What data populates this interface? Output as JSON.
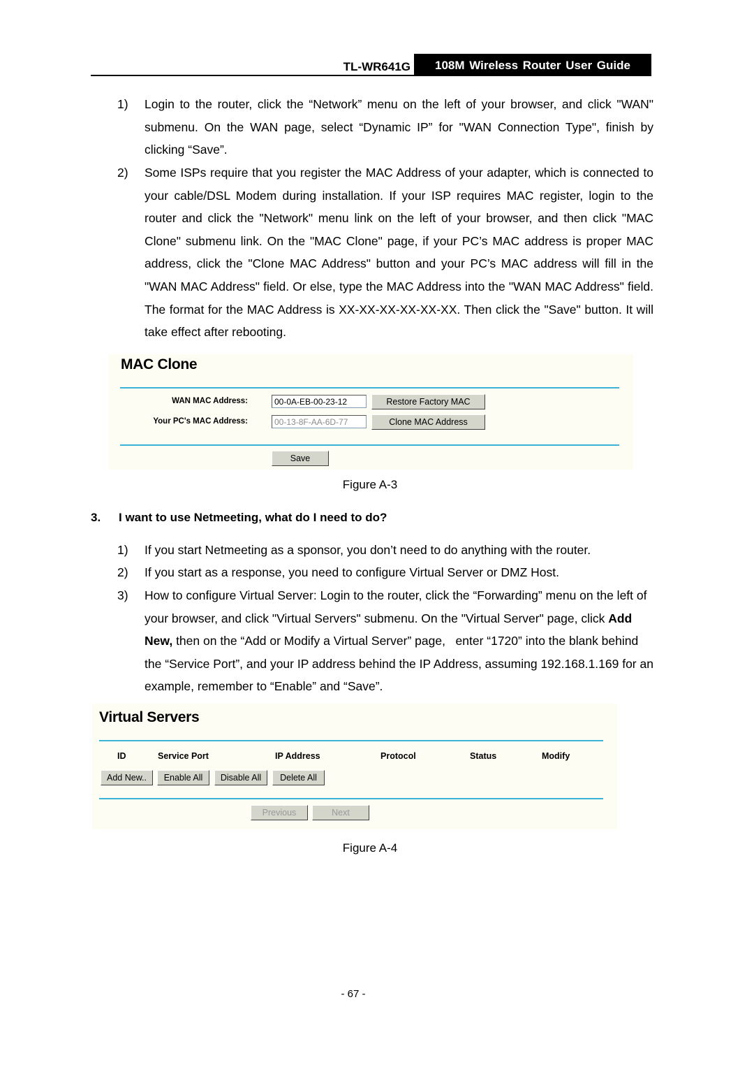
{
  "header": {
    "model": "TL-WR641G",
    "guide_title": "108M Wireless Router User Guide"
  },
  "section_mac": {
    "items": [
      {
        "num": "1)",
        "text": "Login to the router, click the “Network” menu on the left of your browser, and click \"WAN\" submenu. On the WAN page, select “Dynamic IP” for \"WAN Connection Type\", finish by clicking “Save”."
      },
      {
        "num": "2)",
        "text": "Some ISPs require that you register the MAC Address of your adapter, which is connected to your cable/DSL Modem during installation. If your ISP requires MAC register, login to the router and click the \"Network\" menu link on the left of your browser, and then click \"MAC Clone\" submenu link. On the \"MAC Clone\" page, if your PC’s MAC address is proper MAC address, click the \"Clone MAC Address\" button and your PC’s MAC address will fill in the \"WAN MAC Address\" field. Or else, type the MAC Address into the \"WAN MAC Address\" field. The format for the MAC Address is XX-XX-XX-XX-XX-XX. Then click the \"Save\" button. It will take effect after rebooting."
      }
    ]
  },
  "figure_a3": {
    "title": "MAC Clone",
    "wan_mac_label": "WAN MAC Address:",
    "wan_mac_value": "00-0A-EB-00-23-12",
    "restore_button": "Restore Factory MAC",
    "pc_mac_label": "Your PC's MAC Address:",
    "pc_mac_value": "00-13-8F-AA-6D-77",
    "clone_button": "Clone MAC Address",
    "save_button": "Save",
    "caption": "Figure A-3"
  },
  "question3": {
    "num": "3.",
    "title": "I want to use Netmeeting, what do I need to do?",
    "items": [
      {
        "num": "1)",
        "text": "If you start Netmeeting as a sponsor, you don’t need to do anything with the router."
      },
      {
        "num": "2)",
        "text": "If you start as a response, you need to configure Virtual Server or DMZ Host."
      },
      {
        "num": "3)",
        "text_before_bold": "How to configure Virtual Server: Login to the router, click the “Forwarding” menu on the left of your browser, and click \"Virtual Servers\" submenu. On the \"Virtual Server\" page, click ",
        "bold": "Add New,",
        "text_after_bold": " then on the “Add or Modify a Virtual Server” page,   enter “1720” into the blank behind the “Service Port”, and your IP address behind the IP Address, assuming 192.168.1.169 for an example, remember to “Enable” and “Save”."
      }
    ]
  },
  "figure_a4": {
    "title": "Virtual Servers",
    "columns": [
      "ID",
      "Service Port",
      "IP Address",
      "Protocol",
      "Status",
      "Modify"
    ],
    "buttons": [
      "Add New..",
      "Enable All",
      "Disable All",
      "Delete All"
    ],
    "previous_button": "Previous",
    "next_button": "Next",
    "caption": "Figure A-4"
  },
  "footer": {
    "page_number": "- 67 -"
  }
}
